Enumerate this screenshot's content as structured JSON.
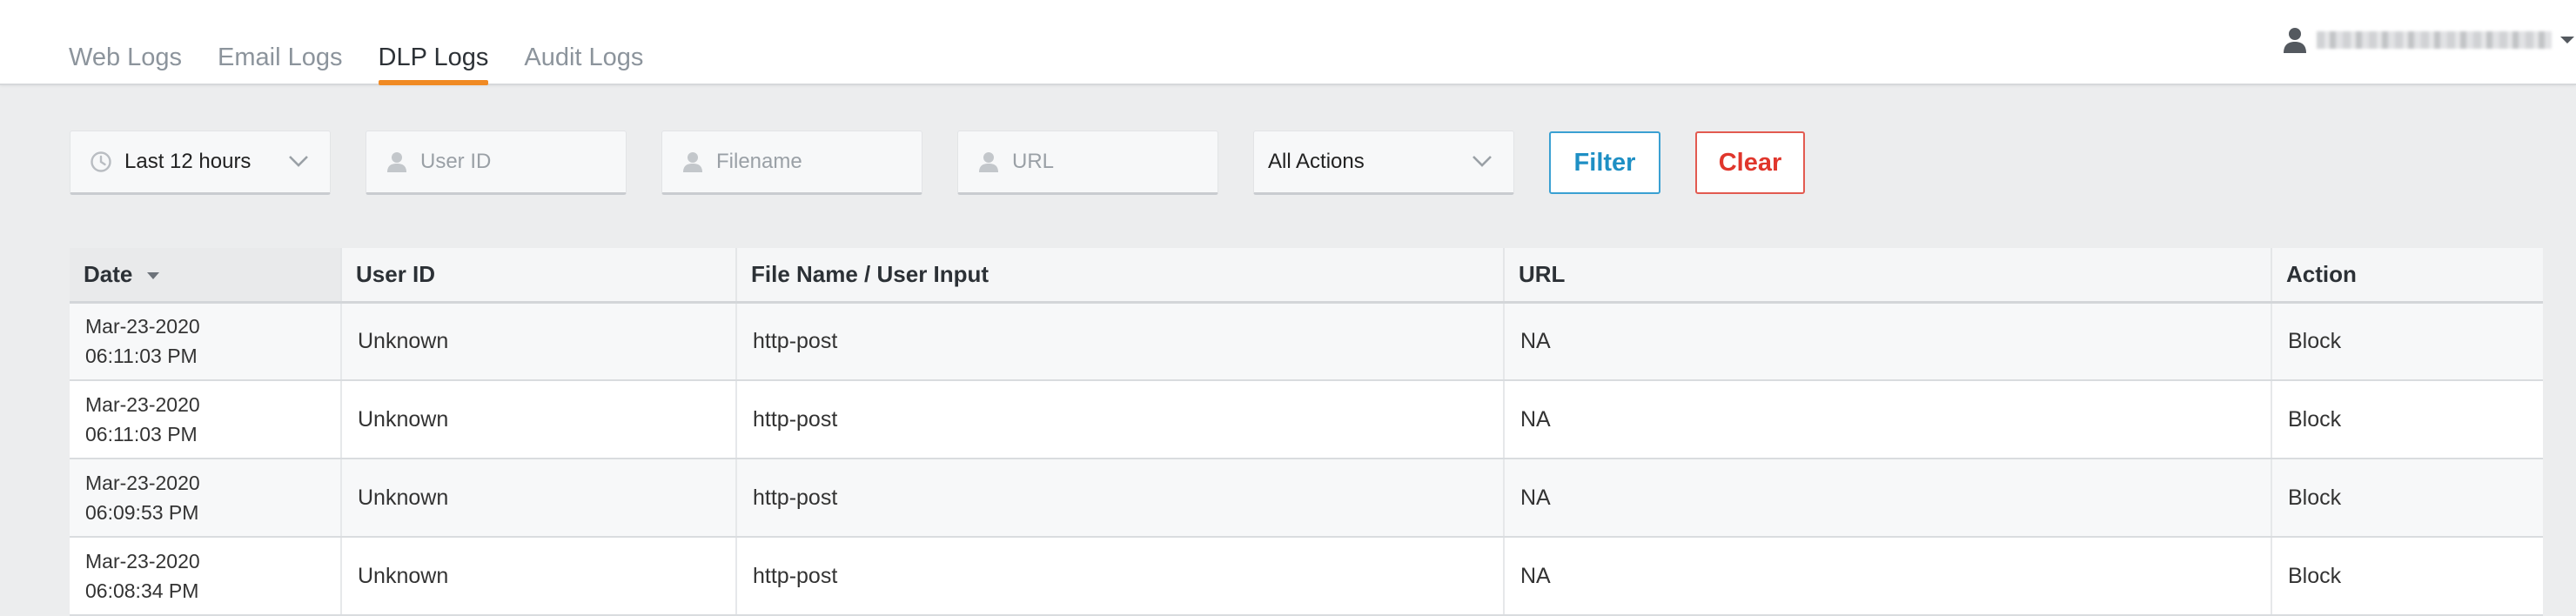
{
  "nav": {
    "tabs": [
      {
        "label": "Web Logs",
        "active": false
      },
      {
        "label": "Email Logs",
        "active": false
      },
      {
        "label": "DLP Logs",
        "active": true
      },
      {
        "label": "Audit Logs",
        "active": false
      }
    ]
  },
  "user": {
    "icon": "user-icon",
    "name": ""
  },
  "filters": {
    "time_range": "Last 12 hours",
    "user_id_placeholder": "User ID",
    "filename_placeholder": "Filename",
    "url_placeholder": "URL",
    "action_select": "All Actions",
    "filter_label": "Filter",
    "clear_label": "Clear"
  },
  "colors": {
    "accent": "#f08a24",
    "filter_button": "#1e8fc4",
    "clear_button": "#e0362c"
  },
  "table": {
    "columns": [
      "Date",
      "User ID",
      "File Name / User Input",
      "URL",
      "Action"
    ],
    "sorted_column": "Date",
    "rows": [
      {
        "date": "Mar-23-2020",
        "time": "06:11:03 PM",
        "user_id": "Unknown",
        "file": "http-post",
        "url": "NA",
        "action": "Block"
      },
      {
        "date": "Mar-23-2020",
        "time": "06:11:03 PM",
        "user_id": "Unknown",
        "file": "http-post",
        "url": "NA",
        "action": "Block"
      },
      {
        "date": "Mar-23-2020",
        "time": "06:09:53 PM",
        "user_id": "Unknown",
        "file": "http-post",
        "url": "NA",
        "action": "Block"
      },
      {
        "date": "Mar-23-2020",
        "time": "06:08:34 PM",
        "user_id": "Unknown",
        "file": "http-post",
        "url": "NA",
        "action": "Block"
      }
    ]
  }
}
